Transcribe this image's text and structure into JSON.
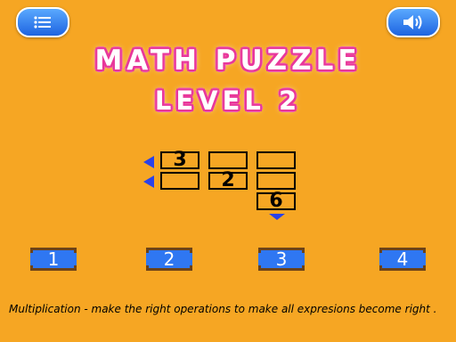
{
  "header": {
    "menu_icon": "list-icon",
    "sound_icon": "speaker-volume-icon"
  },
  "title": "MATH PUZZLE",
  "level": "LEVEL 2",
  "puzzle": {
    "grid": [
      [
        "3",
        "",
        ""
      ],
      [
        "",
        "2",
        ""
      ],
      [
        "6"
      ]
    ]
  },
  "number_buttons": [
    "1",
    "2",
    "3",
    "4"
  ],
  "instructions": "Multiplication - make the right operations to make all expresions become right .",
  "colors": {
    "background": "#f6a623",
    "button_blue": "#2f77f2",
    "arrow_blue": "#2a42e8",
    "title_pink": "#e8379a"
  }
}
